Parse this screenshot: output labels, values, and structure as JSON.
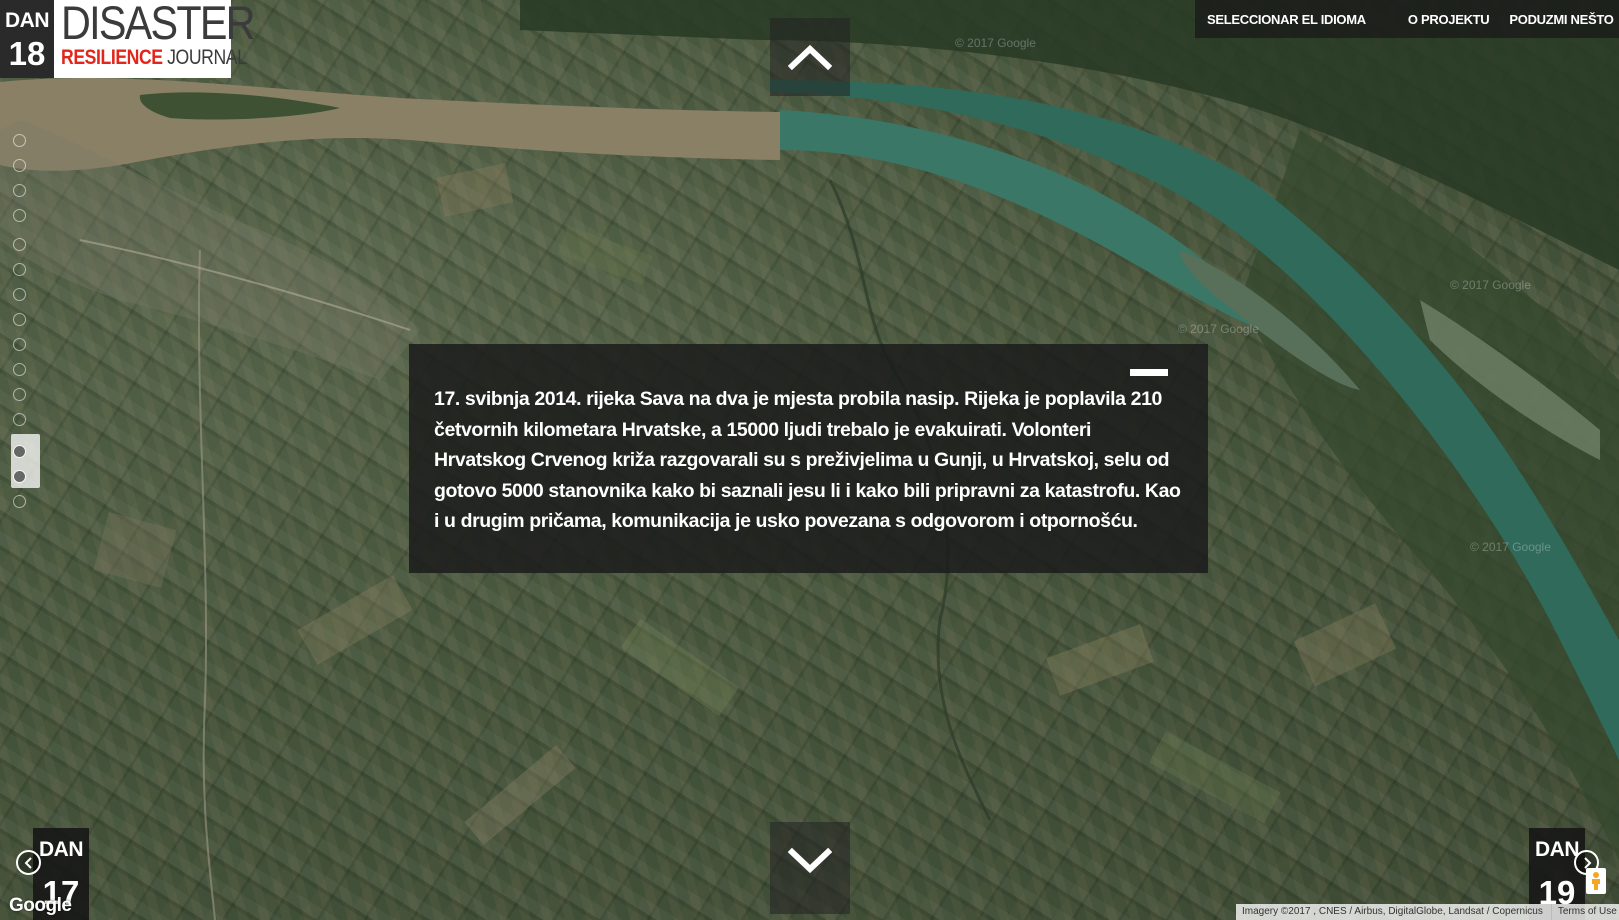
{
  "logo": {
    "day_label": "DAN",
    "day_number": "18",
    "line1": "DISASTER",
    "line2_red": "RESILIENCE",
    "line2_rest": " JOURNAL"
  },
  "nav": {
    "language": "SELECCIONAR EL IDIOMA",
    "about": "O PROJEKTU",
    "share": "PODUZMI NEŠTO"
  },
  "panel": {
    "text": "17. svibnja 2014. rijeka Sava na dva je mjesta probila nasip. Rijeka je poplavila 210 četvornih kilometara Hrvatske, a 15000 ljudi trebalo je evakuirati. Volonteri Hrvatskog Crvenog križa razgovarali su s preživjelima u Gunji, u Hrvatskoj, selu od gotovo 5000 stanovnika kako bi saznali jesu li i kako bili pripravni za katastrofu. Kao i u drugim pričama, komunikacija je usko povezana s odgovorom i otpornošću."
  },
  "prev_day": {
    "label": "DAN",
    "number": "17"
  },
  "next_day": {
    "label": "DAN",
    "number": "19"
  },
  "map": {
    "google": "Google",
    "imagery": "Imagery ©2017 , CNES / Airbus, DigitalGlobe, Landsat / Copernicus",
    "terms": "Terms of Use",
    "watermark": "© 2017 Google"
  },
  "colors": {
    "accent_red": "#e1261c",
    "river": "#2f6a5a",
    "river_muddy": "#8b8166"
  },
  "icons": {
    "globe": "globe-icon",
    "speaker": "speaker-icon",
    "up": "chevron-up-icon",
    "down": "chevron-down-icon",
    "prev": "chevron-left-circle-icon",
    "next": "chevron-right-circle-icon",
    "pegman": "pegman-icon"
  }
}
